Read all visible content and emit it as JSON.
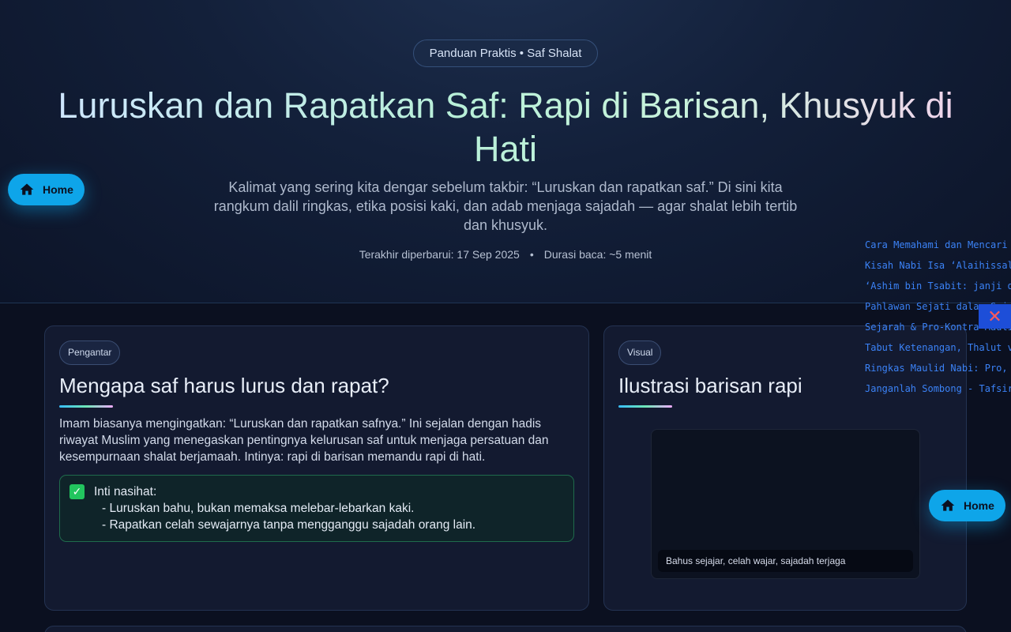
{
  "hero": {
    "pill": "Panduan Praktis • Saf Shalat",
    "title": "Luruskan dan Rapatkan Saf: Rapi di Barisan, Khusyuk di Hati",
    "subtitle": "Kalimat yang sering kita dengar sebelum takbir: “Luruskan dan rapatkan saf.” Di sini kita rangkum dalil ringkas, etika posisi kaki, dan adab menjaga sajadah — agar shalat lebih tertib dan khusyuk.",
    "updated": "Terakhir diperbarui: 17 Sep 2025",
    "read_time": "Durasi baca: ~5 menit"
  },
  "home_button": {
    "label": "Home",
    "icon": "home-icon"
  },
  "intro_card": {
    "tag": "Pengantar",
    "title": "Mengapa saf harus lurus dan rapat?",
    "body": "Imam biasanya mengingatkan: “Luruskan dan rapatkan safnya.” Ini sejalan dengan hadis riwayat Muslim yang menegaskan pentingnya kelurusan saf untuk menjaga persatuan dan kesempurnaan shalat berjamaah. Intinya: rapi di barisan memandu rapi di hati.",
    "tip_title": "Inti nasihat:",
    "tip_lines": [
      "- Luruskan bahu, bukan memaksa melebar-lebarkan kaki.",
      "- Rapatkan celah sewajarnya tanpa mengganggu sajadah orang lain."
    ]
  },
  "visual_card": {
    "tag": "Visual",
    "title": "Ilustrasi barisan rapi",
    "caption": "Bahus sejajar, celah wajar, sajadah terjaga"
  },
  "side_links": [
    "Cara Memahami dan Mencari Ke",
    "Kisah Nabi Isa ‘Alaihissalam:",
    "‘Ashim bin Tsabit: janji di p",
    "Pahlawan Sejati dalam Sej",
    "Sejarah & Pro-Kontra Maulid N",
    "Tabut Ketenangan, Thalut vs J",
    "Ringkas Maulid Nabi: Pro, Kon",
    "Janganlah Sombong - Tafsir, E"
  ],
  "close_icon": "close-icon",
  "colors": {
    "accent": "#0ea5e9",
    "link": "#3b82f6",
    "close": "#ff5a5a"
  }
}
